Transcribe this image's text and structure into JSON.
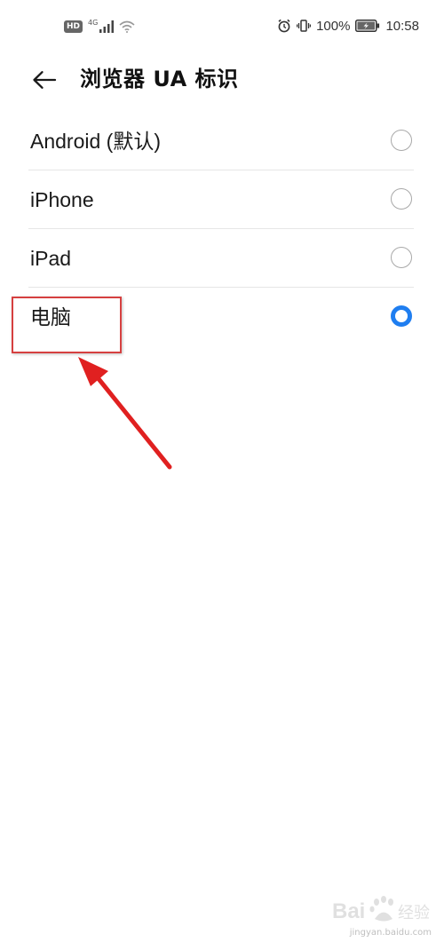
{
  "status_bar": {
    "hd_badge": "HD",
    "network_type": "4G",
    "battery_percent": "100%",
    "time": "10:58"
  },
  "header": {
    "title": "浏览器 UA 标识"
  },
  "options": [
    {
      "label": "Android (默认)",
      "selected": false
    },
    {
      "label": "iPhone",
      "selected": false
    },
    {
      "label": "iPad",
      "selected": false
    },
    {
      "label": "电脑",
      "selected": true
    }
  ],
  "colors": {
    "radio_selected": "#1f7ef0",
    "annotation": "#d64040"
  },
  "watermark": {
    "text": "Baidu 经验",
    "url": "jingyan.baidu.com"
  }
}
